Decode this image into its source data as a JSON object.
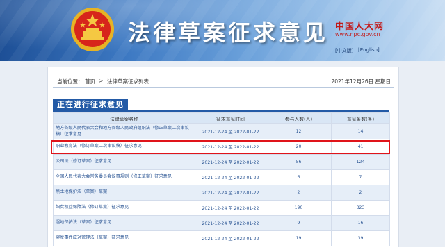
{
  "banner": {
    "title": "法律草案征求意见",
    "logo_cn": "中国人大网",
    "logo_url": "www.npc.gov.cn",
    "lang_zh": "[中文版]",
    "lang_en": "[English]"
  },
  "breadcrumb": {
    "prefix": "当前位置：",
    "home": "首页",
    "separator": ">",
    "current": "法律草案征求列表",
    "date": "2021年12月26日 星期日"
  },
  "section_title": "正在进行征求意见",
  "table": {
    "headers": [
      "法律草案名称",
      "征求意见时间",
      "参与人数(人)",
      "意见条数(条)"
    ],
    "rows": [
      {
        "name": "地方各级人民代表大会和地方各级人民政府组织法（修正草案二次审议稿）征求意见",
        "period": "2021-12-24 至 2022-01-22",
        "participants": "12",
        "opinions": "14"
      },
      {
        "name": "职业教育法（修订草案二次审议稿）征求意见",
        "period": "2021-12-24 至 2022-01-22",
        "participants": "20",
        "opinions": "41"
      },
      {
        "name": "公司法（修订草案）征求意见",
        "period": "2021-12-24 至 2022-01-22",
        "participants": "56",
        "opinions": "124"
      },
      {
        "name": "全国人民代表大会常务委员会议事规则（修正草案）征求意见",
        "period": "2021-12-24 至 2022-01-22",
        "participants": "6",
        "opinions": "7"
      },
      {
        "name": "黑土地保护法（草案）草案",
        "period": "2021-12-24 至 2022-01-22",
        "participants": "2",
        "opinions": "2"
      },
      {
        "name": "妇女权益保障法（修订草案）征求意见",
        "period": "2021-12-24 至 2022-01-22",
        "participants": "190",
        "opinions": "323"
      },
      {
        "name": "湿地保护法（草案）征求意见",
        "period": "2021-12-24 至 2022-01-22",
        "participants": "9",
        "opinions": "16"
      },
      {
        "name": "突发事件应对管理法（草案）征求意见",
        "period": "2021-12-24 至 2022-01-22",
        "participants": "19",
        "opinions": "39"
      }
    ]
  },
  "colors": {
    "accent": "#235aa6",
    "highlight": "#e0141a",
    "link": "#2d5795"
  }
}
